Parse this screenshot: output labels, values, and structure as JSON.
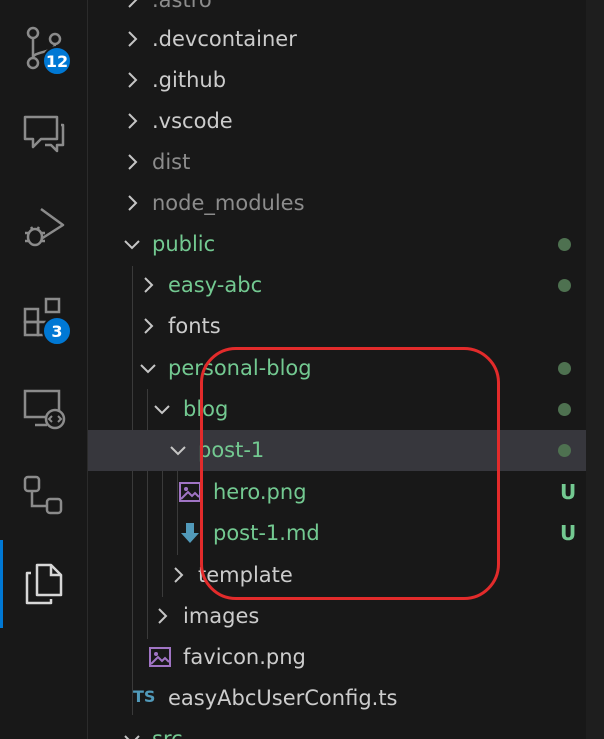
{
  "activity_bar": {
    "items": [
      {
        "name": "source-control",
        "badge": "12"
      },
      {
        "name": "chat",
        "badge": null
      },
      {
        "name": "run-and-debug",
        "badge": null
      },
      {
        "name": "extensions",
        "badge": "3"
      },
      {
        "name": "remote-explorer",
        "badge": null
      },
      {
        "name": "git-graph",
        "badge": null
      },
      {
        "name": "explorer",
        "badge": null
      }
    ],
    "active": "explorer",
    "badge_color": "#0078d4"
  },
  "tree": {
    "items": [
      {
        "label": ".astro"
      },
      {
        "label": ".devcontainer"
      },
      {
        "label": ".github"
      },
      {
        "label": ".vscode"
      },
      {
        "label": "dist"
      },
      {
        "label": "node_modules"
      },
      {
        "label": "public"
      },
      {
        "label": "easy-abc"
      },
      {
        "label": "fonts"
      },
      {
        "label": "personal-blog"
      },
      {
        "label": "blog"
      },
      {
        "label": "post-1"
      },
      {
        "label": "hero.png",
        "status": "U"
      },
      {
        "label": "post-1.md",
        "status": "U"
      },
      {
        "label": "template"
      },
      {
        "label": "images"
      },
      {
        "label": "favicon.png"
      },
      {
        "label": "easyAbcUserConfig.ts",
        "icon_text": "TS"
      },
      {
        "label": "src"
      }
    ]
  },
  "colors": {
    "git_added": "#73c991",
    "highlight_border": "#e22b2b",
    "selected_row": "#37373d"
  }
}
